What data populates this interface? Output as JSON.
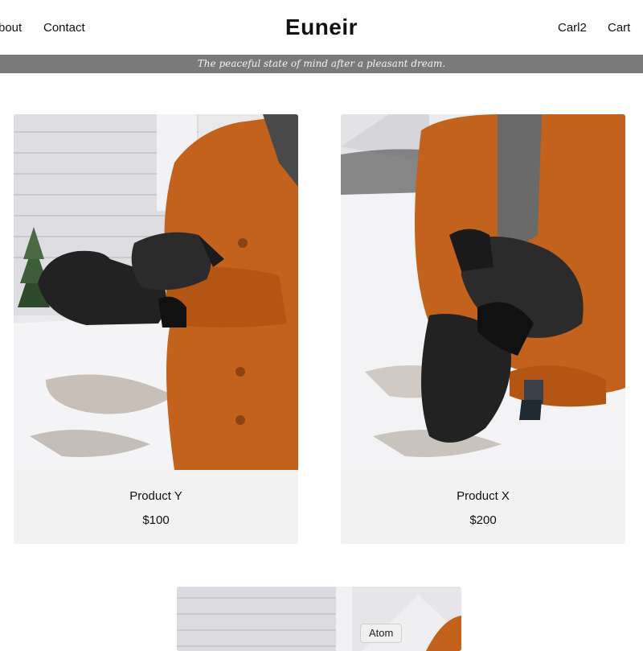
{
  "nav": {
    "about_label": "bout",
    "contact_label": "Contact",
    "brand": "Euneir",
    "account_label": "Carl2",
    "cart_label": "Cart"
  },
  "banner": {
    "tagline": "The peaceful state of mind after a pleasant dream."
  },
  "products": [
    {
      "name": "Product Y",
      "price": "$100"
    },
    {
      "name": "Product X",
      "price": "$200"
    }
  ],
  "tooltip": {
    "text": "Atom"
  },
  "colors": {
    "banner_bg": "#7a7a7a",
    "card_bg": "#f2f2f2",
    "coat_orange": "#c2621c",
    "mitten_black": "#222222"
  },
  "icons": []
}
